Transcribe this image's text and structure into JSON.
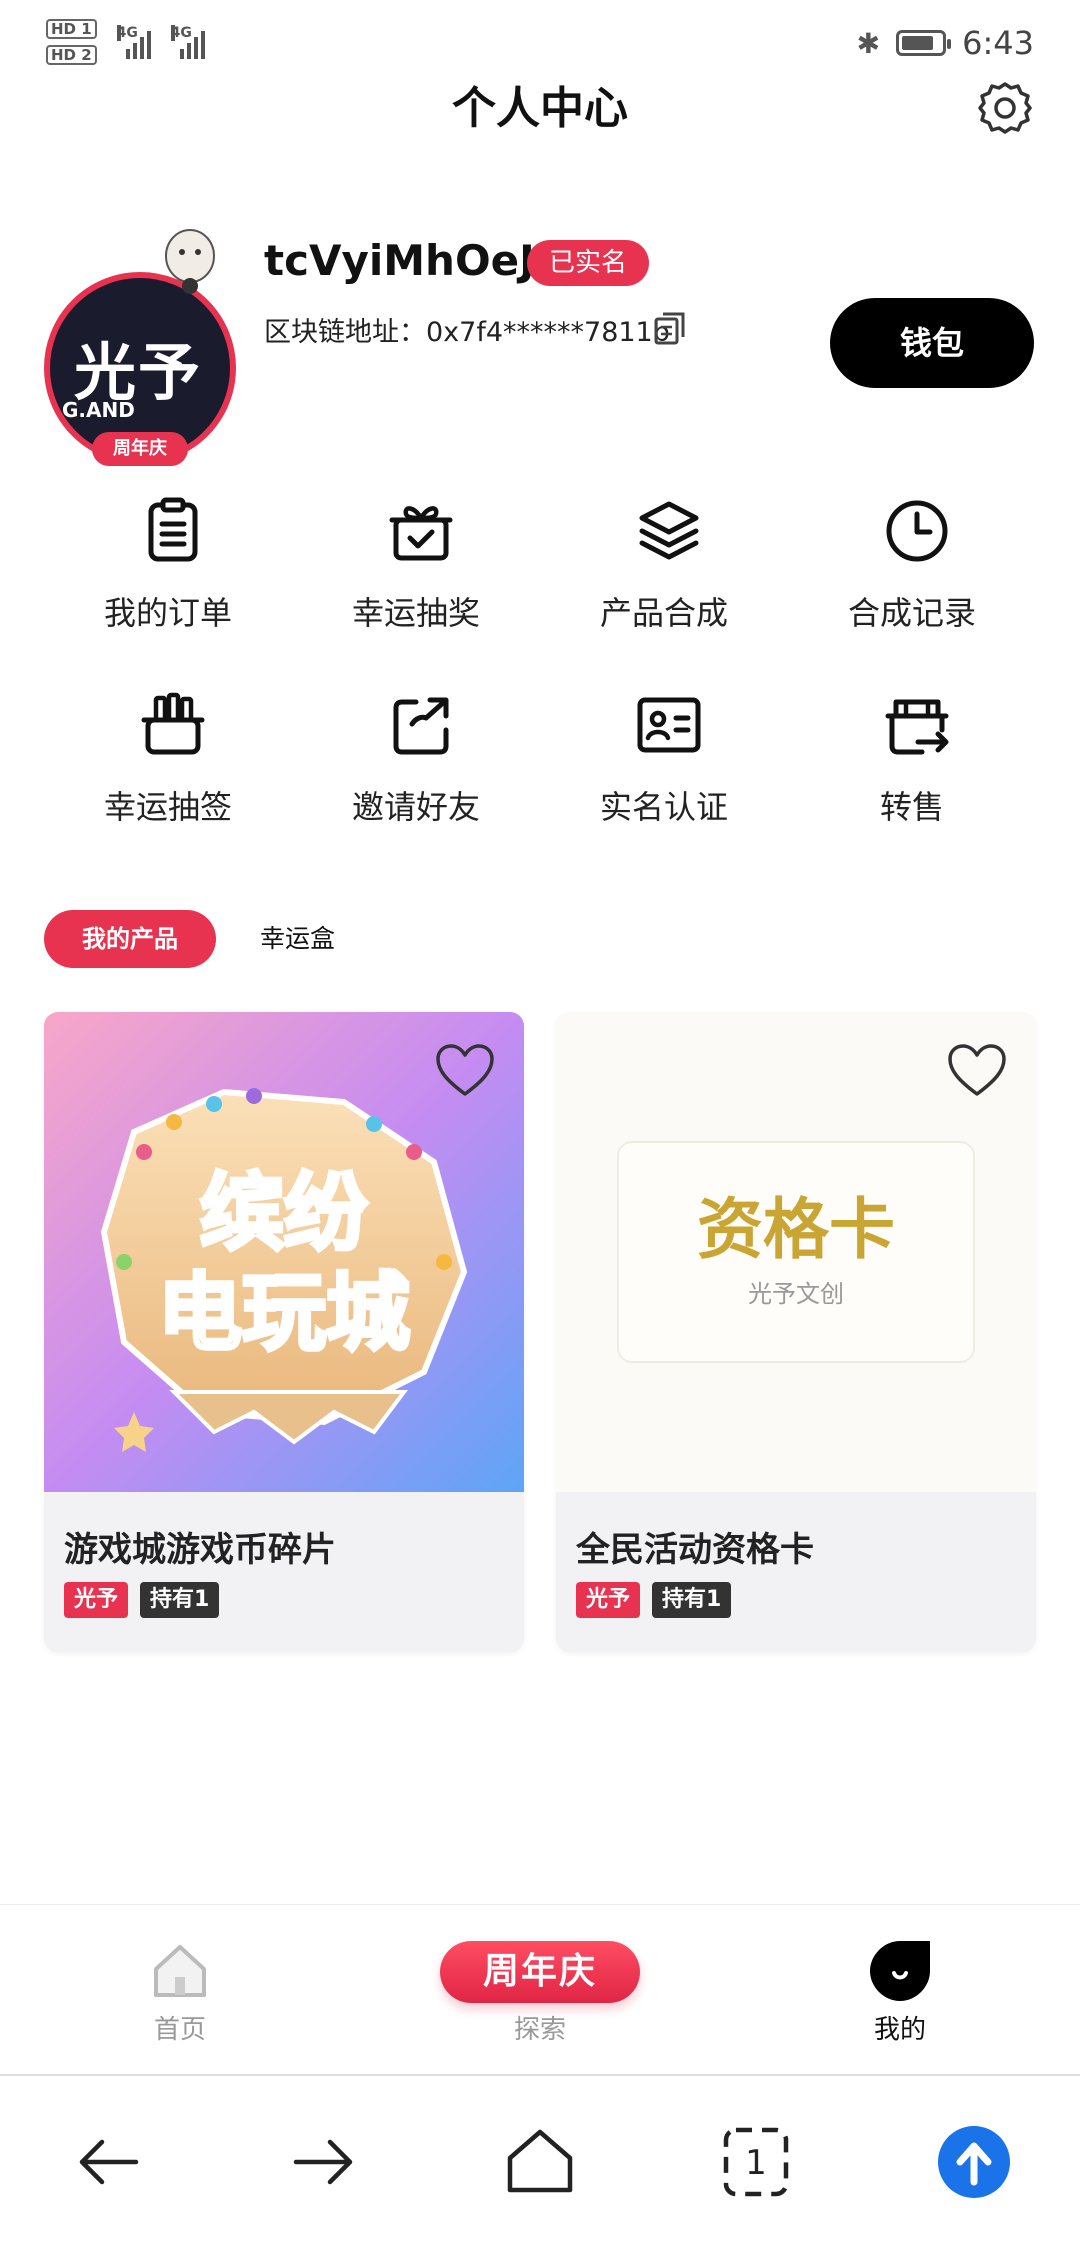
{
  "status_bar": {
    "sim1": "HD 1",
    "sim2": "HD 2",
    "net1": "4G",
    "net2": "4G",
    "time": "6:43",
    "battery_level": 0.8
  },
  "header": {
    "title": "个人中心"
  },
  "profile": {
    "avatar_text": "光予",
    "avatar_sub": "G.AND",
    "avatar_ribbon": "周年庆",
    "username": "tcVyiMhOeJ",
    "verified_label": "已实名",
    "chain_label": "区块链地址：",
    "chain_address": "0x7f4******7811b",
    "wallet_label": "钱包"
  },
  "menu": [
    {
      "label": "我的订单",
      "icon": "order-icon"
    },
    {
      "label": "幸运抽奖",
      "icon": "gift-icon"
    },
    {
      "label": "产品合成",
      "icon": "layers-icon"
    },
    {
      "label": "合成记录",
      "icon": "clock-icon"
    },
    {
      "label": "幸运抽签",
      "icon": "lottery-icon"
    },
    {
      "label": "邀请好友",
      "icon": "share-icon"
    },
    {
      "label": "实名认证",
      "icon": "id-card-icon"
    },
    {
      "label": "转售",
      "icon": "resale-icon"
    }
  ],
  "tabs": {
    "active": "我的产品",
    "inactive": "幸运盒"
  },
  "products": [
    {
      "title": "游戏城游戏币碎片",
      "image_text": "缤纷电玩城",
      "brand": "光予",
      "holding": "持有1",
      "favorited": false
    },
    {
      "title": "全民活动资格卡",
      "image_text": "资格卡",
      "image_sub": "光予文创",
      "brand": "光予",
      "holding": "持有1",
      "favorited": false
    }
  ],
  "bottom_nav": {
    "home": "首页",
    "explore_badge": "周年庆",
    "explore": "探索",
    "mine": "我的",
    "active": "mine"
  },
  "colors": {
    "accent": "#e83350",
    "dark": "#000000",
    "browser_up": "#1a73e8"
  }
}
